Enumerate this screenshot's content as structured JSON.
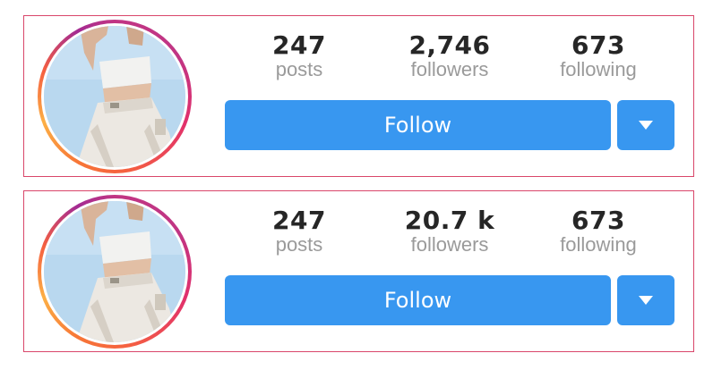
{
  "cards": [
    {
      "stats": [
        {
          "value": "247",
          "label": "posts"
        },
        {
          "value": "2,746",
          "label": "followers"
        },
        {
          "value": "673",
          "label": "following"
        }
      ],
      "follow_label": "Follow",
      "dropdown_icon": "chevron-down-icon"
    },
    {
      "stats": [
        {
          "value": "247",
          "label": "posts"
        },
        {
          "value": "20.7 k",
          "label": "followers"
        },
        {
          "value": "673",
          "label": "following"
        }
      ],
      "follow_label": "Follow",
      "dropdown_icon": "chevron-down-icon"
    }
  ],
  "colors": {
    "button": "#3897f0",
    "border": "#d9466a",
    "stat_value": "#262626",
    "stat_label": "#9a9a9a"
  }
}
